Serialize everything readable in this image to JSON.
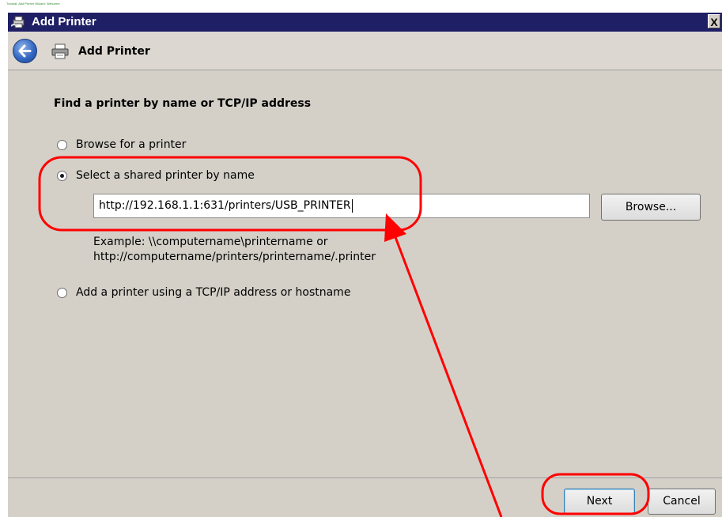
{
  "caption": "Tutorial: Add Printer Wizard: Welcome",
  "window": {
    "title": "Add Printer",
    "close_label": "X"
  },
  "nav": {
    "title": "Add Printer"
  },
  "content": {
    "heading": "Find a printer by name or TCP/IP address",
    "options": [
      {
        "label": "Browse for a printer",
        "selected": false
      },
      {
        "label": "Select a shared printer by name",
        "selected": true
      },
      {
        "label": "Add a printer using a TCP/IP address or hostname",
        "selected": false
      }
    ],
    "printer_url": "http://192.168.1.1:631/printers/USB_PRINTER",
    "browse_label": "Browse...",
    "example_line1": "Example: \\\\computername\\printername or",
    "example_line2": "http://computername/printers/printername/.printer"
  },
  "footer": {
    "next_label": "Next",
    "cancel_label": "Cancel"
  },
  "annotation_color": "#ff0000"
}
